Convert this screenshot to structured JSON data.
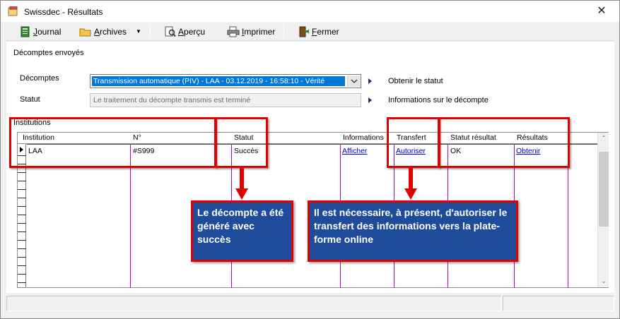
{
  "window": {
    "title": "Swissdec - Résultats"
  },
  "toolbar": {
    "journal": "Journal",
    "archives": "Archives",
    "apercu": "Aperçu",
    "imprimer": "Imprimer",
    "fermer": "Fermer"
  },
  "section": {
    "title": "Décomptes envoyés"
  },
  "form": {
    "decomptes_label": "Décomptes",
    "decomptes_value": "Transmission automatique (PIV) - LAA - 03.12.2019 - 16:58:10 - Vérité",
    "statut_label": "Statut",
    "statut_value": "Le traitement du décompte transmis est terminé",
    "obtenir_statut": "Obtenir le statut",
    "informations_decompte": "Informations sur le décompte"
  },
  "institutions": {
    "label": "Institutions",
    "columns": [
      "Institution",
      "N°",
      "Statut",
      "Informations",
      "Transfert",
      "Statut résultat",
      "Résultats"
    ],
    "rows": [
      {
        "institution": "LAA",
        "numero": "#S999",
        "statut": "Succès",
        "informations": "Afficher",
        "transfert": "Autoriser",
        "statut_resultat": "OK",
        "resultats": "Obtenir"
      }
    ]
  },
  "annotations": {
    "callout_left": "Le décompte a été généré avec succès",
    "callout_right": "Il est nécessaire, à présent, d'autoriser le transfert des informations vers la plate-forme online"
  },
  "colors": {
    "highlight": "#e00000",
    "callout_bg": "#1f4c9a",
    "selection": "#0078d7",
    "column_rule": "#c000c0"
  }
}
